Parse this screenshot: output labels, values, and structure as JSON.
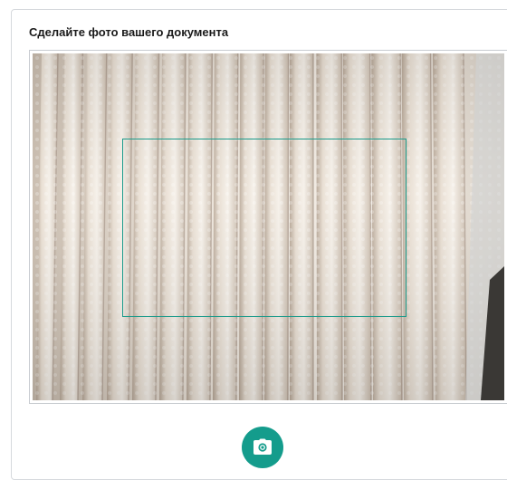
{
  "dialog": {
    "title": "Сделайте фото вашего документа"
  },
  "camera": {
    "guide_color": "#1a9a8a"
  },
  "capture": {
    "icon": "camera-icon",
    "color": "#149c8c"
  }
}
